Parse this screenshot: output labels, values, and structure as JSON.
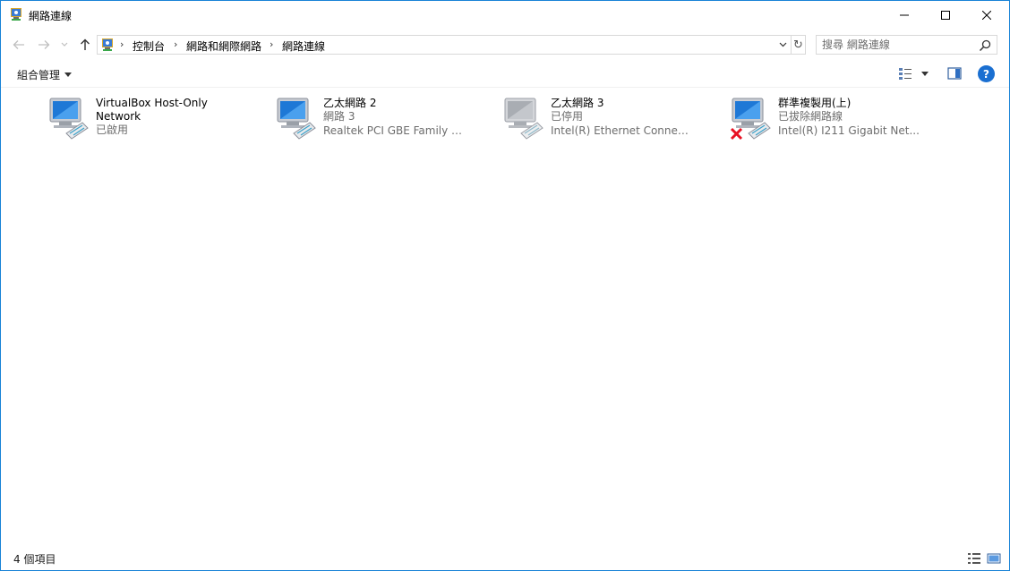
{
  "window": {
    "title": "網路連線",
    "title_icon": "network-connections-icon"
  },
  "address": {
    "breadcrumbs": [
      "控制台",
      "網路和網際網路",
      "網路連線"
    ],
    "search_placeholder": "搜尋 網路連線"
  },
  "toolbar": {
    "organize_label": "組合管理"
  },
  "connections": [
    {
      "name_line1": "VirtualBox Host-Only",
      "name_line2": "Network",
      "status": "已啟用",
      "device": "",
      "state": "enabled-color"
    },
    {
      "name_line1": "乙太網路 2",
      "name_line2": "",
      "status": "網路 3",
      "device": "Realtek PCI GBE Family C...",
      "state": "enabled-color"
    },
    {
      "name_line1": "乙太網路 3",
      "name_line2": "",
      "status": "已停用",
      "device": "Intel(R) Ethernet Connecti...",
      "state": "disabled-gray"
    },
    {
      "name_line1": "群準複製用(上)",
      "name_line2": "",
      "status": "已拔除網路線",
      "device": "Intel(R) I211 Gigabit Net...",
      "state": "unplugged-red-x"
    }
  ],
  "statusbar": {
    "item_count": "4 個項目"
  },
  "colors": {
    "accent": "#1883d7",
    "help": "#1a6fd1",
    "error_x": "#e81123"
  }
}
